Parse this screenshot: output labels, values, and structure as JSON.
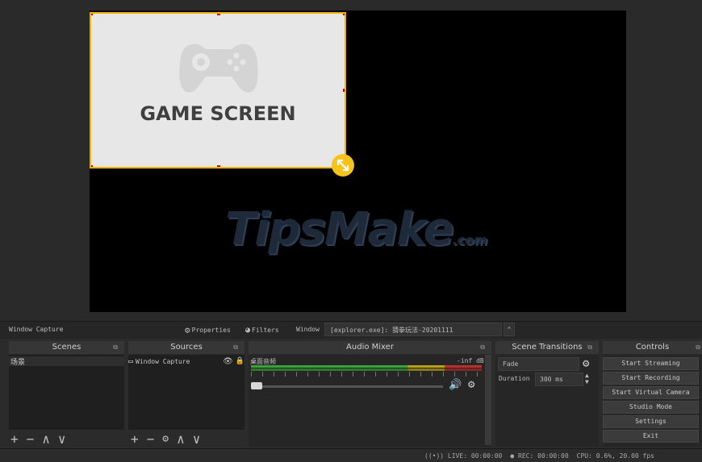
{
  "preview": {
    "source_label": "GAME SCREEN",
    "watermark": {
      "main": "TipsMake",
      "suffix": ".com"
    }
  },
  "source_toolbar": {
    "source_name": "Window Capture",
    "properties_label": "Properties",
    "filters_label": "Filters",
    "window_label": "Window",
    "window_value": "[explorer.exe]: 猜拳玩法-20201111"
  },
  "docks": {
    "scenes": {
      "title": "Scenes",
      "items": [
        "场景"
      ]
    },
    "sources": {
      "title": "Sources",
      "items": [
        "Window Capture"
      ]
    },
    "audio_mixer": {
      "title": "Audio Mixer",
      "track_name": "桌面音频",
      "db": "-inf dB"
    },
    "scene_transitions": {
      "title": "Scene Transitions",
      "transition": "Fade",
      "duration_label": "Duration",
      "duration_value": "300 ms"
    },
    "controls": {
      "title": "Controls",
      "buttons": [
        "Start Streaming",
        "Start Recording",
        "Start Virtual Camera",
        "Studio Mode",
        "Settings",
        "Exit"
      ]
    }
  },
  "status_bar": {
    "live": "LIVE: 00:00:00",
    "rec": "REC: 00:00:00",
    "cpu": "CPU: 0.6%, 20.00 fps"
  },
  "colors": {
    "selection": "#f0b400",
    "accent": "#f7c31a"
  }
}
